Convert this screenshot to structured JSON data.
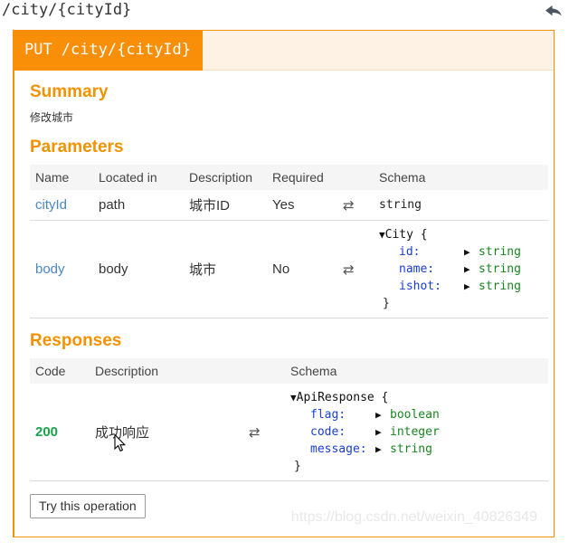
{
  "topbar": {
    "endpoint_path": "/city/{cityId}",
    "back_icon": "back-arrow-icon"
  },
  "operation": {
    "method": "PUT",
    "path": "/city/{cityId}",
    "accent_color": "#f98e09",
    "header_bg": "#fdf2e4"
  },
  "summary": {
    "title": "Summary",
    "text": "修改城市"
  },
  "parameters": {
    "title": "Parameters",
    "columns": [
      "Name",
      "Located in",
      "Description",
      "Required",
      "Schema"
    ],
    "rows": [
      {
        "name": "cityId",
        "located_in": "path",
        "description": "城市ID",
        "required": "Yes",
        "toggle_icon": "⇄",
        "schema_type": "string"
      },
      {
        "name": "body",
        "located_in": "body",
        "description": "城市",
        "required": "No",
        "toggle_icon": "⇄",
        "model": {
          "caret": "▼",
          "name": "City",
          "open_brace": "{",
          "close_brace": "}",
          "properties": [
            {
              "prop": "id:",
              "expander": "▶",
              "type": "string"
            },
            {
              "prop": "name:",
              "expander": "▶",
              "type": "string"
            },
            {
              "prop": "ishot:",
              "expander": "▶",
              "type": "string"
            }
          ]
        }
      }
    ]
  },
  "responses": {
    "title": "Responses",
    "columns": [
      "Code",
      "Description",
      "Schema"
    ],
    "rows": [
      {
        "code": "200",
        "description": "成功响应",
        "toggle_icon": "⇄",
        "model": {
          "caret": "▼",
          "name": "ApiResponse",
          "open_brace": "{",
          "close_brace": "}",
          "properties": [
            {
              "prop": "flag:",
              "expander": "▶",
              "type": "boolean"
            },
            {
              "prop": "code:",
              "expander": "▶",
              "type": "integer"
            },
            {
              "prop": "message:",
              "expander": "▶",
              "type": "string"
            }
          ]
        }
      }
    ]
  },
  "footer": {
    "try_button": "Try this operation"
  },
  "watermark": {
    "text": "https://blog.csdn.net/weixin_40826349"
  },
  "colors": {
    "accent": "#f39200",
    "method_tab": "#f98e09",
    "link": "#4a87c6",
    "success": "#18a34a",
    "type": "#18861f",
    "prop": "#1a3fd0"
  }
}
